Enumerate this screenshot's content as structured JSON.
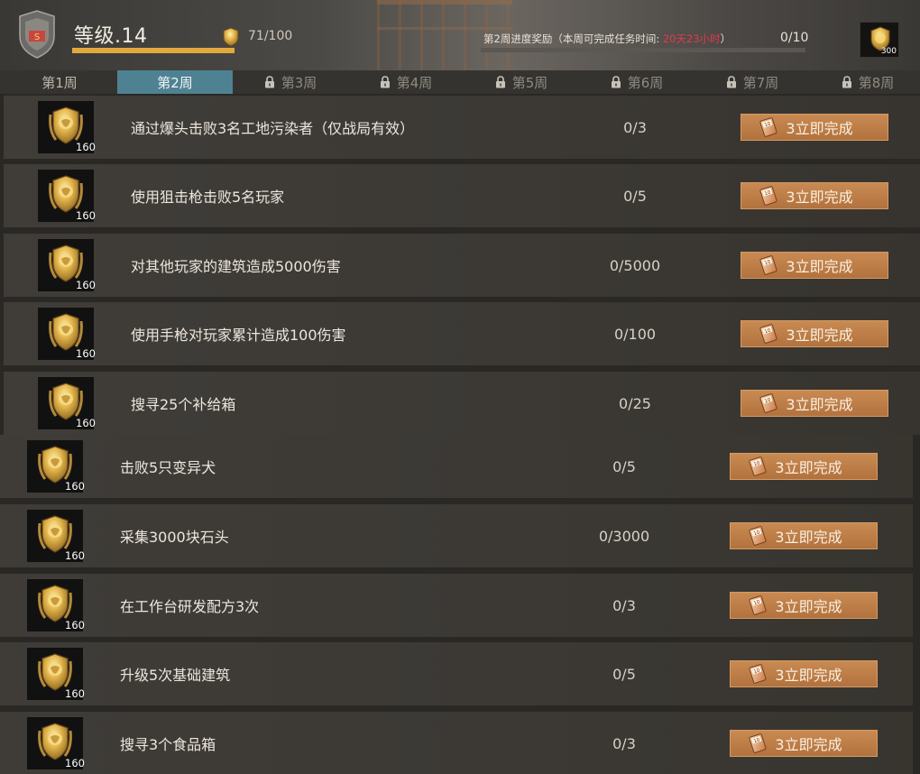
{
  "header": {
    "level_title": "等级.14",
    "level_progress": 1.0,
    "xp_text": "71/100",
    "week_progress_prefix": "第2周进度奖励（本周可完成任务时间: ",
    "week_progress_time": "20天23小时",
    "week_progress_suffix": "）",
    "week_progress_count": "0/10",
    "week_progress_fraction": 0,
    "reward_count": "300",
    "colors": {
      "level_bar": "#e2a93c",
      "time_highlight": "#e23a4a",
      "active_tab": "#4e8293",
      "complete_button": "#b2723e"
    }
  },
  "tabs": [
    {
      "label": "第1周",
      "state": "normal"
    },
    {
      "label": "第2周",
      "state": "active"
    },
    {
      "label": "第3周",
      "state": "locked"
    },
    {
      "label": "第4周",
      "state": "locked"
    },
    {
      "label": "第5周",
      "state": "locked"
    },
    {
      "label": "第6周",
      "state": "locked"
    },
    {
      "label": "第7周",
      "state": "locked"
    },
    {
      "label": "第8周",
      "state": "locked"
    }
  ],
  "tasks": [
    {
      "icon": "medal-icon",
      "reward": "160",
      "text": "通过爆头击败3名工地污染者（仅战局有效）",
      "progress": "0/3",
      "button": "3立即完成"
    },
    {
      "icon": "medal-icon",
      "reward": "160",
      "text": "使用狙击枪击败5名玩家",
      "progress": "0/5",
      "button": "3立即完成"
    },
    {
      "icon": "medal-icon",
      "reward": "160",
      "text": "对其他玩家的建筑造成5000伤害",
      "progress": "0/5000",
      "button": "3立即完成"
    },
    {
      "icon": "medal-icon",
      "reward": "160",
      "text": "使用手枪对玩家累计造成100伤害",
      "progress": "0/100",
      "button": "3立即完成"
    },
    {
      "icon": "medal-icon",
      "reward": "160",
      "text": "搜寻25个补给箱",
      "progress": "0/25",
      "button": "3立即完成"
    },
    {
      "icon": "medal-icon",
      "reward": "160",
      "text": "击败5只变异犬",
      "progress": "0/5",
      "button": "3立即完成"
    },
    {
      "icon": "medal-icon",
      "reward": "160",
      "text": "采集3000块石头",
      "progress": "0/3000",
      "button": "3立即完成"
    },
    {
      "icon": "medal-icon",
      "reward": "160",
      "text": "在工作台研发配方3次",
      "progress": "0/3",
      "button": "3立即完成"
    },
    {
      "icon": "medal-icon",
      "reward": "160",
      "text": "升级5次基础建筑",
      "progress": "0/5",
      "button": "3立即完成"
    },
    {
      "icon": "medal-icon",
      "reward": "160",
      "text": "搜寻3个食品箱",
      "progress": "0/3",
      "button": "3立即完成"
    }
  ]
}
